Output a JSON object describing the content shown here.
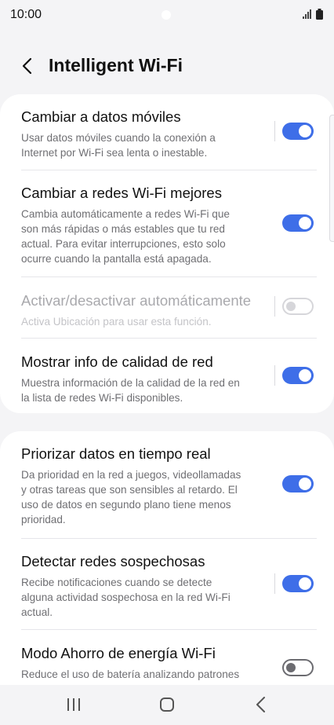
{
  "status_bar": {
    "time": "10:00"
  },
  "header": {
    "title": "Intelligent Wi-Fi"
  },
  "settings": [
    {
      "title": "Cambiar a datos móviles",
      "lines": [
        "Usar datos móviles cuando la conexión a",
        "Internet por Wi-Fi sea lenta o inestable."
      ],
      "state": "on"
    },
    {
      "title": "Cambiar a redes Wi-Fi mejores",
      "lines": [
        "Cambia automáticamente a redes Wi-Fi que",
        "son más rápidas o más estables que tu red",
        "actual. Para evitar interrupciones, esto solo",
        "ocurre cuando la pantalla está apagada."
      ],
      "state": "on"
    },
    {
      "title": "Activar/desactivar automáticamente",
      "lines": [
        "Activa Ubicación para usar esta función."
      ],
      "state": "disabled"
    },
    {
      "title": "Mostrar info de calidad de red",
      "lines": [
        "Muestra información de la calidad de la red en",
        "la lista de redes Wi-Fi disponibles."
      ],
      "state": "on"
    },
    {
      "title": "Priorizar datos en tiempo real",
      "lines": [
        "Da prioridad en la red a juegos, videollamadas",
        "y otras tareas que son sensibles al retardo. El",
        "uso de datos en segundo plano tiene menos",
        "prioridad."
      ],
      "state": "on"
    },
    {
      "title": "Detectar redes sospechosas",
      "lines": [
        "Recibe notificaciones cuando se detecte",
        "alguna actividad sospechosa en la red Wi-Fi",
        "actual."
      ],
      "state": "on"
    },
    {
      "title": "Modo Ahorro de energía Wi-Fi",
      "lines": [
        "Reduce el uso de batería analizando patrones"
      ],
      "state": "off"
    }
  ]
}
